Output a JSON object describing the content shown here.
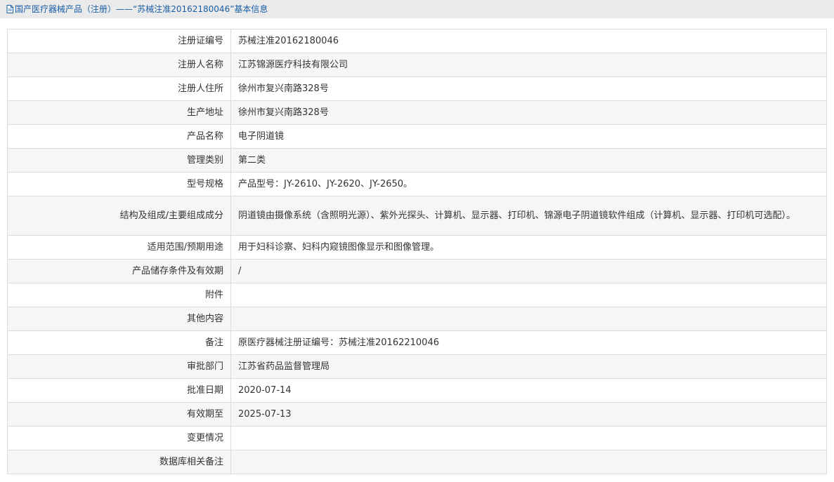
{
  "breadcrumb": {
    "text": "国产医疗器械产品（注册）——“苏械注准20162180046”基本信息"
  },
  "rows": [
    {
      "label": "注册证编号",
      "value": "苏械注准20162180046"
    },
    {
      "label": "注册人名称",
      "value": "江苏锦源医疗科技有限公司"
    },
    {
      "label": "注册人住所",
      "value": "徐州市复兴南路328号"
    },
    {
      "label": "生产地址",
      "value": "徐州市复兴南路328号"
    },
    {
      "label": "产品名称",
      "value": "电子阴道镜"
    },
    {
      "label": "管理类别",
      "value": "第二类"
    },
    {
      "label": "型号规格",
      "value": "产品型号：JY-2610、JY-2620、JY-2650。"
    },
    {
      "label": "结构及组成/主要组成成分",
      "value": "阴道镜由摄像系统（含照明光源）、紫外光探头、计算机、显示器、打印机、锦源电子阴道镜软件组成（计算机、显示器、打印机可选配）。"
    },
    {
      "label": "适用范围/预期用途",
      "value": "用于妇科诊察、妇科内窥镜图像显示和图像管理。"
    },
    {
      "label": "产品储存条件及有效期",
      "value": "/"
    },
    {
      "label": "附件",
      "value": ""
    },
    {
      "label": "其他内容",
      "value": ""
    },
    {
      "label": "备注",
      "value": "原医疗器械注册证编号：苏械注准20162210046"
    },
    {
      "label": "审批部门",
      "value": "江苏省药品监督管理局"
    },
    {
      "label": "批准日期",
      "value": "2020-07-14"
    },
    {
      "label": "有效期至",
      "value": "2025-07-13"
    },
    {
      "label": "变更情况",
      "value": ""
    },
    {
      "label": "数据库相关备注",
      "value": ""
    }
  ]
}
